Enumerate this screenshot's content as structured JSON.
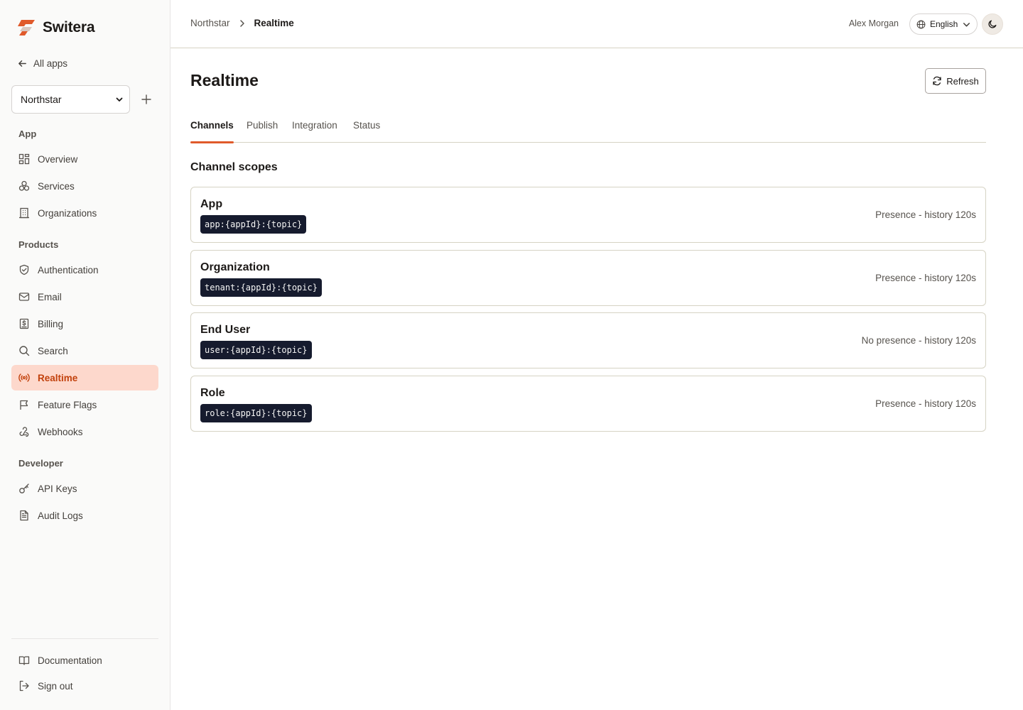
{
  "brand": {
    "name": "Switera",
    "accent": "#e05a2b"
  },
  "sidebar": {
    "back_label": "All apps",
    "app_select": {
      "value": "Northstar"
    },
    "sections": {
      "app": "App",
      "products": "Products",
      "developer": "Developer"
    },
    "items": {
      "overview": "Overview",
      "services": "Services",
      "organizations": "Organizations",
      "authentication": "Authentication",
      "email": "Email",
      "billing": "Billing",
      "search": "Search",
      "realtime": "Realtime",
      "feature_flags": "Feature Flags",
      "webhooks": "Webhooks",
      "api_keys": "API Keys",
      "audit_logs": "Audit Logs",
      "documentation": "Documentation",
      "sign_out": "Sign out"
    },
    "active_item": "realtime"
  },
  "header": {
    "breadcrumb": {
      "parent": "Northstar",
      "current": "Realtime"
    },
    "user_name": "Alex Morgan",
    "language": "English"
  },
  "main": {
    "title": "Realtime",
    "refresh_label": "Refresh",
    "tabs": {
      "channels": "Channels",
      "publish": "Publish",
      "integration": "Integration",
      "status": "Status"
    },
    "active_tab": "channels",
    "section_heading": "Channel scopes",
    "scopes": [
      {
        "name": "App",
        "pattern": "app:{appId}:{topic}",
        "meta": "Presence - history 120s"
      },
      {
        "name": "Organization",
        "pattern": "tenant:{appId}:{topic}",
        "meta": "Presence - history 120s"
      },
      {
        "name": "End User",
        "pattern": "user:{appId}:{topic}",
        "meta": "No presence - history 120s"
      },
      {
        "name": "Role",
        "pattern": "role:{appId}:{topic}",
        "meta": "Presence - history 120s"
      }
    ]
  }
}
